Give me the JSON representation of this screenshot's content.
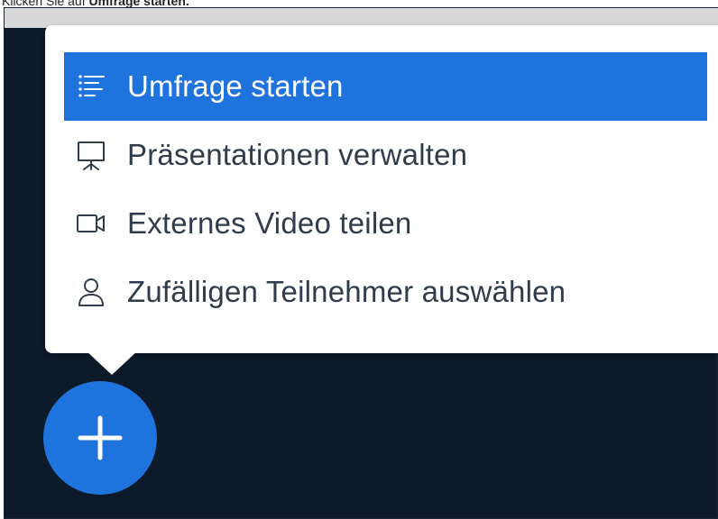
{
  "caption": {
    "prefix": "Klicken Sie auf ",
    "bold": "Umfrage starten."
  },
  "menu": {
    "items": [
      {
        "label": "Umfrage starten",
        "icon": "poll-list-icon",
        "active": true
      },
      {
        "label": "Präsentationen verwalten",
        "icon": "presentation-icon",
        "active": false
      },
      {
        "label": "Externes Video teilen",
        "icon": "video-camera-icon",
        "active": false
      },
      {
        "label": "Zufälligen Teilnehmer auswählen",
        "icon": "user-icon",
        "active": false
      }
    ]
  },
  "fab": {
    "icon": "plus-icon"
  },
  "colors": {
    "accent": "#1f73dd",
    "background": "#0d1a2a",
    "menu_text": "#303b4b",
    "menu_bg": "#ffffff"
  }
}
